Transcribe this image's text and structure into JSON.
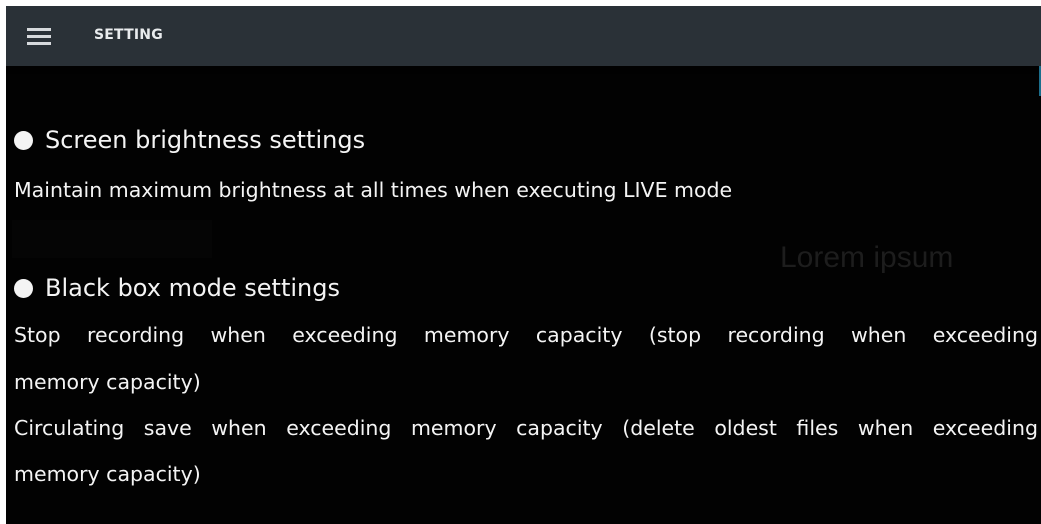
{
  "appbar": {
    "title": "SETTING"
  },
  "sections": [
    {
      "heading": "Screen brightness settings",
      "lines": [
        "Maintain maximum brightness at all times when executing LIVE mode"
      ]
    },
    {
      "heading": "Black box mode settings",
      "lines": [
        "Stop recording when exceeding memory capacity (stop recording when exceeding",
        "memory capacity)",
        "Circulating save when exceeding memory capacity (delete oldest files when exceeding",
        "memory capacity)"
      ]
    }
  ],
  "watermark": "Lorem ipsum",
  "icons": {
    "menu": "hamburger-menu-icon",
    "bullet": "filled-circle-bullet-icon"
  },
  "colors": {
    "appbar": "#2a3137",
    "background": "#020202",
    "text": "#f4f4f4"
  }
}
